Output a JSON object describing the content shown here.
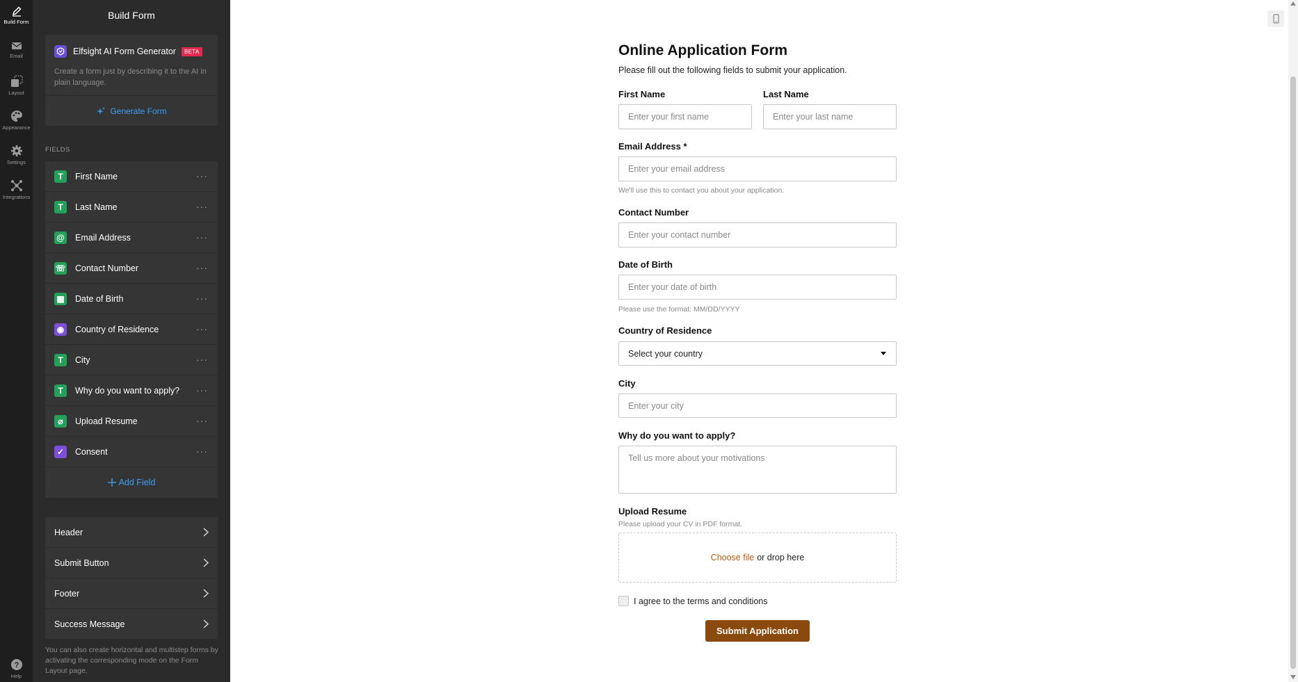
{
  "rail": {
    "items": [
      {
        "label": "Build Form",
        "icon": "pencil-icon"
      },
      {
        "label": "Email",
        "icon": "envelope-icon"
      },
      {
        "label": "Layout",
        "icon": "layout-icon"
      },
      {
        "label": "Appearance",
        "icon": "palette-icon"
      },
      {
        "label": "Settings",
        "icon": "gear-icon"
      },
      {
        "label": "Integrations",
        "icon": "integrations-icon"
      }
    ],
    "help": {
      "label": "Help",
      "icon": "help-icon"
    }
  },
  "sidebar": {
    "title": "Build Form",
    "ai": {
      "name": "Elfsight AI Form Generator",
      "badge": "BETA",
      "description": "Create a form just by describing it to the AI in plain language.",
      "button": "Generate Form"
    },
    "fields_label": "FIELDS",
    "fields": [
      {
        "label": "First Name",
        "icon": "text-icon",
        "glyph": "T"
      },
      {
        "label": "Last Name",
        "icon": "text-icon",
        "glyph": "T"
      },
      {
        "label": "Email Address",
        "icon": "at-icon",
        "glyph": "@"
      },
      {
        "label": "Contact Number",
        "icon": "phone-icon",
        "glyph": "☏"
      },
      {
        "label": "Date of Birth",
        "icon": "calendar-icon",
        "glyph": "▦"
      },
      {
        "label": "Country of Residence",
        "icon": "dropdown-icon",
        "glyph": "◉"
      },
      {
        "label": "City",
        "icon": "text-icon",
        "glyph": "T"
      },
      {
        "label": "Why do you want to apply?",
        "icon": "textarea-icon",
        "glyph": "T"
      },
      {
        "label": "Upload Resume",
        "icon": "paperclip-icon",
        "glyph": "⌀"
      },
      {
        "label": "Consent",
        "icon": "checkbox-icon",
        "glyph": "✓"
      }
    ],
    "field_menu": "···",
    "add_field": "Add Field",
    "sections": [
      "Header",
      "Submit Button",
      "Footer",
      "Success Message"
    ],
    "note": "You can also create horizontal and multistep forms by activating the corresponding mode on the Form Layout page."
  },
  "form": {
    "title": "Online Application Form",
    "subtitle": "Please fill out the following fields to submit your application.",
    "first_name": {
      "label": "First Name",
      "placeholder": "Enter your first name"
    },
    "last_name": {
      "label": "Last Name",
      "placeholder": "Enter your last name"
    },
    "email": {
      "label": "Email Address *",
      "placeholder": "Enter your email address",
      "hint": "We'll use this to contact you about your application."
    },
    "contact": {
      "label": "Contact Number",
      "placeholder": "Enter your contact number"
    },
    "dob": {
      "label": "Date of Birth",
      "placeholder": "Enter your date of birth",
      "hint": "Please use the format: MM/DD/YYYY"
    },
    "country": {
      "label": "Country of Residence",
      "value": "Select your country"
    },
    "city": {
      "label": "City",
      "placeholder": "Enter your city"
    },
    "why": {
      "label": "Why do you want to apply?",
      "placeholder": "Tell us more about your motivations"
    },
    "resume": {
      "label": "Upload Resume",
      "hint": "Please upload your CV in PDF format.",
      "choose": "Choose file",
      "drop": "or drop here"
    },
    "consent": "I agree to the terms and conditions",
    "submit": "Submit Application"
  },
  "colors": {
    "accent_blue": "#3b9ef5",
    "submit_brown": "#8b4a0d",
    "choose_file": "#b85d10",
    "field_icon_green": "#23a05a",
    "field_icon_purple": "#7c4fd8",
    "beta_badge": "#e5294e"
  }
}
